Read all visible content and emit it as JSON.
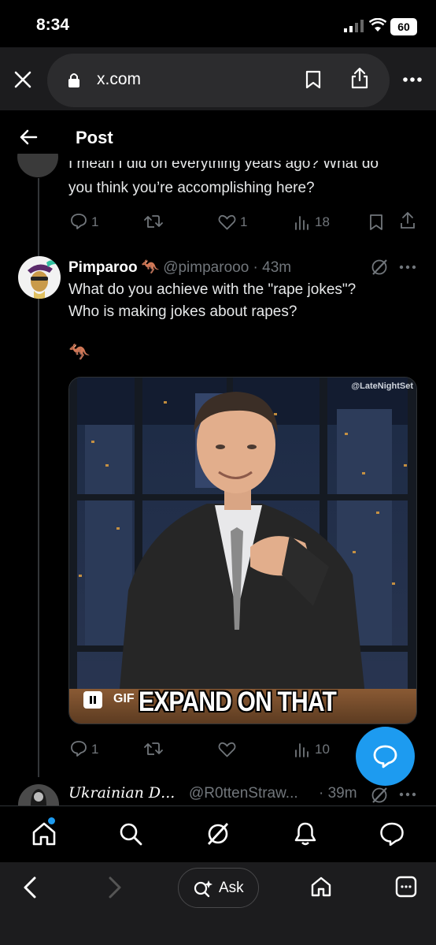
{
  "status_bar": {
    "time": "8:34",
    "battery": "60"
  },
  "browser": {
    "url": "x.com"
  },
  "header": {
    "title": "Post"
  },
  "reply_context": {
    "text_line1": "I mean I did on everything years ago? What do",
    "text_line2": "you think you’re accomplishing here?",
    "replies": "1",
    "likes": "1",
    "views": "18"
  },
  "tweet": {
    "display_name": "Pimparoo",
    "name_emoji": "🦘",
    "handle_time": "@pimparooo · 43m",
    "text_line1": "What do you achieve with the \"rape jokes\"?",
    "text_line2": "Who is making jokes about rapes?",
    "emoji_line": "🦘",
    "media": {
      "watermark": "@LateNightSet",
      "badge": "GIF",
      "caption": "EXPAND ON THAT"
    },
    "replies": "1",
    "views": "10"
  },
  "next_tweet": {
    "display_name": "𝑈𝑘𝑟𝑎𝑖𝑛𝑖𝑎𝑛 𝐷...",
    "handle": "@R0ttenStraw...",
    "time": "· 39m"
  },
  "safari": {
    "ask_label": "Ask"
  },
  "colors": {
    "accent": "#1d9bf0",
    "muted": "#71767b",
    "background": "#000000"
  }
}
